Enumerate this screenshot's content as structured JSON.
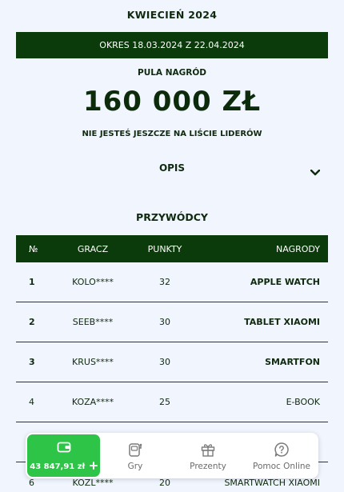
{
  "page": {
    "title": "KWIECIEŃ 2024",
    "period": "OKRES 18.03.2024 Z 22.04.2024",
    "prize_pool_label": "PULA NAGRÓD",
    "prize_pool_amount": "160 000 ZŁ",
    "not_on_leaderboard": "NIE JESTEŚ JESZCZE NA LIŚCIE LIDERÓW",
    "description_label": "OPIS",
    "leaders_title": "PRZYWÓDCY"
  },
  "table": {
    "headers": {
      "rank": "№",
      "player": "GRACZ",
      "points": "PUNKTY",
      "prize": "NAGRODY"
    },
    "rows": [
      {
        "rank": "1",
        "player": "KOLO****",
        "points": "32",
        "prize": "APPLE WATCH",
        "highlight": true
      },
      {
        "rank": "2",
        "player": "SEEB****",
        "points": "30",
        "prize": "TABLET XIAOMI",
        "highlight": true
      },
      {
        "rank": "3",
        "player": "KRUS****",
        "points": "30",
        "prize": "SMARTFON",
        "highlight": true
      },
      {
        "rank": "4",
        "player": "KOZA****",
        "points": "25",
        "prize": "E-BOOK",
        "highlight": false
      },
      {
        "rank": "5",
        "player": "",
        "points": "",
        "prize": "",
        "highlight": false
      },
      {
        "rank": "6",
        "player": "KOZL****",
        "points": "20",
        "prize": "SMARTWATCH XIAOMI",
        "highlight": false
      }
    ]
  },
  "nav": {
    "wallet_amount": "43 847,91 zł",
    "games_label": "Gry",
    "gifts_label": "Prezenty",
    "help_label": "Pomoc Online"
  },
  "colors": {
    "dark_green": "#0b3b0b",
    "accent_green": "#2ec447",
    "background": "#f1f5fd"
  },
  "icons": [
    "chevron-down-icon",
    "wallet-icon",
    "plus-icon",
    "games-icon",
    "gift-icon",
    "help-icon"
  ]
}
